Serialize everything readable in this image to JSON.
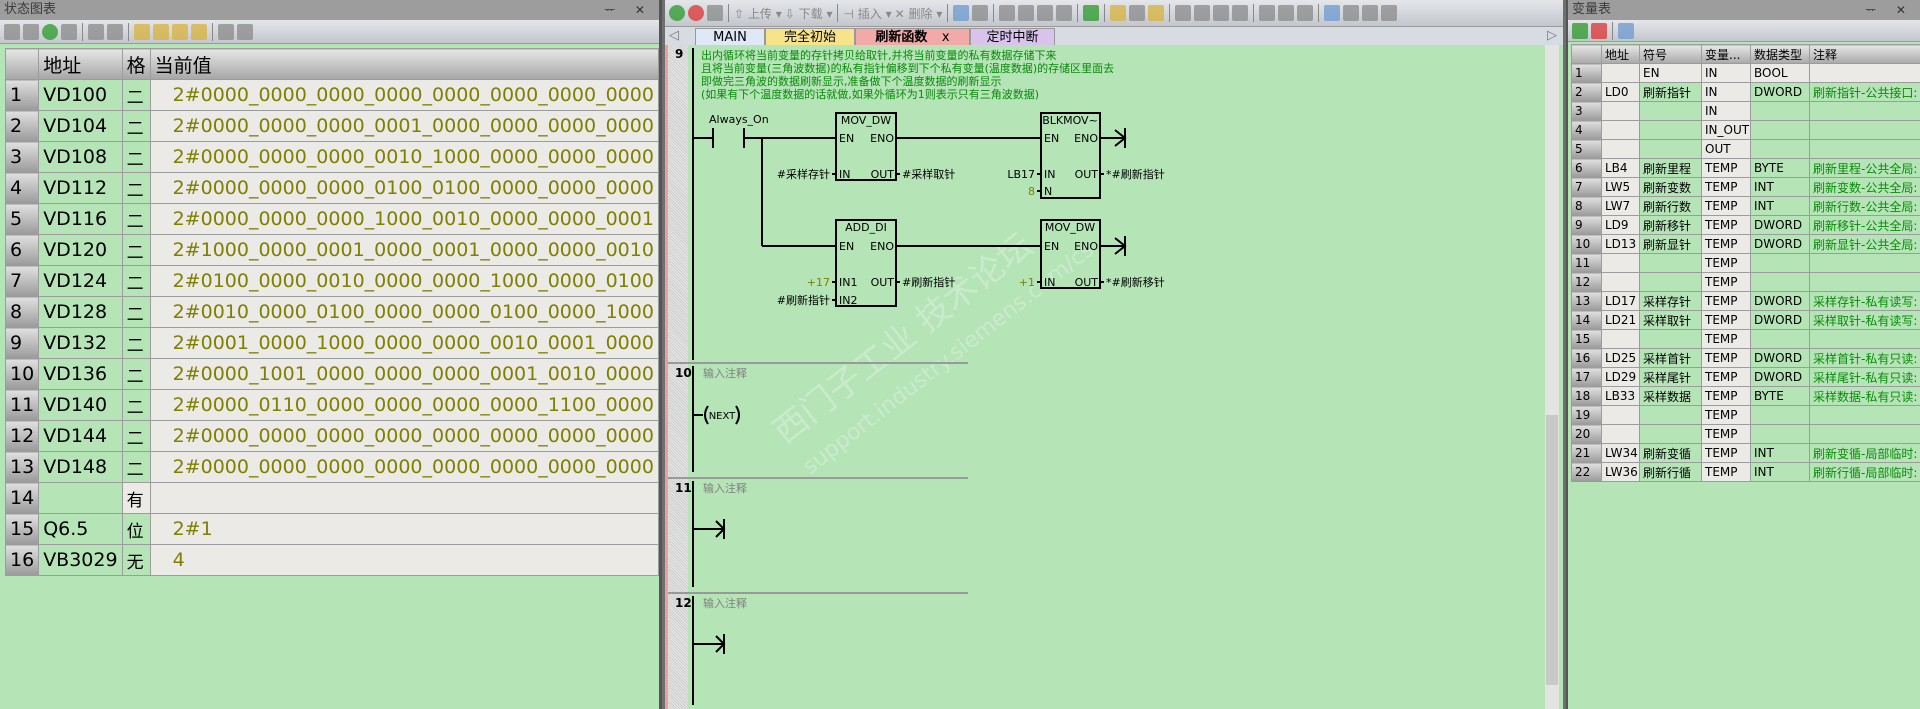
{
  "status_chart": {
    "title": "状态图表",
    "window_controls": "ᅲ ✕",
    "toolbar_icons": [
      "add-row-icon",
      "delete-row-icon",
      "chart-run-icon",
      "pause-icon",
      "read-icon",
      "write-icon",
      "force-icon",
      "unforce-icon",
      "unforce-all-icon",
      "read-forced-icon",
      "trend-icon",
      "tag-icon"
    ],
    "columns": [
      "",
      "地址",
      "格",
      "当前值"
    ],
    "rows": [
      {
        "n": "1",
        "addr": "VD100",
        "fmt": "二",
        "value": "2#0000_0000_0000_0000_0000_0000_0000_0000"
      },
      {
        "n": "2",
        "addr": "VD104",
        "fmt": "二",
        "value": "2#0000_0000_0000_0001_0000_0000_0000_0000"
      },
      {
        "n": "3",
        "addr": "VD108",
        "fmt": "二",
        "value": "2#0000_0000_0000_0010_1000_0000_0000_0000"
      },
      {
        "n": "4",
        "addr": "VD112",
        "fmt": "二",
        "value": "2#0000_0000_0000_0100_0100_0000_0000_0000"
      },
      {
        "n": "5",
        "addr": "VD116",
        "fmt": "二",
        "value": "2#0000_0000_0000_1000_0010_0000_0000_0001"
      },
      {
        "n": "6",
        "addr": "VD120",
        "fmt": "二",
        "value": "2#1000_0000_0001_0000_0001_0000_0000_0010"
      },
      {
        "n": "7",
        "addr": "VD124",
        "fmt": "二",
        "value": "2#0100_0000_0010_0000_0000_1000_0000_0100"
      },
      {
        "n": "8",
        "addr": "VD128",
        "fmt": "二",
        "value": "2#0010_0000_0100_0000_0000_0100_0000_1000"
      },
      {
        "n": "9",
        "addr": "VD132",
        "fmt": "二",
        "value": "2#0001_0000_1000_0000_0000_0010_0001_0000"
      },
      {
        "n": "10",
        "addr": "VD136",
        "fmt": "二",
        "value": "2#0000_1001_0000_0000_0000_0001_0010_0000"
      },
      {
        "n": "11",
        "addr": "VD140",
        "fmt": "二",
        "value": "2#0000_0110_0000_0000_0000_0000_1100_0000"
      },
      {
        "n": "12",
        "addr": "VD144",
        "fmt": "二",
        "value": "2#0000_0000_0000_0000_0000_0000_0000_0000"
      },
      {
        "n": "13",
        "addr": "VD148",
        "fmt": "二",
        "value": "2#0000_0000_0000_0000_0000_0000_0000_0000"
      },
      {
        "n": "14",
        "addr": "",
        "fmt": "有",
        "value": ""
      },
      {
        "n": "15",
        "addr": "Q6.5",
        "fmt": "位",
        "value": "2#1"
      },
      {
        "n": "16",
        "addr": "VB3029",
        "fmt": "无",
        "value": "4"
      }
    ]
  },
  "editor": {
    "toolbar": {
      "upload": "上传",
      "download": "下载",
      "insert": "插入",
      "delete": "删除"
    },
    "tabs": [
      {
        "label": "MAIN",
        "color": "#dfe8f6"
      },
      {
        "label": "完全初始",
        "color": "#f7e38a"
      },
      {
        "label": "刷新函数",
        "color": "#f2aaa8",
        "active": true,
        "close": "x"
      },
      {
        "label": "定时中断",
        "color": "#d9c3ec"
      }
    ],
    "networks": [
      {
        "no": "9",
        "comment": [
          "出内循环将当前变量的存针拷贝给取针,并将当前变量的私有数据存储下来",
          "且将当前变量(三角波数据)的私有指针偏移到下个私有变量(温度数据)的存储区里面去",
          "即做完三角波的数据刷新显示,准备做下个温度数据的刷新显示",
          "(如果有下个温度数据的话就做,如果外循环为1则表示只有三角波数据)"
        ],
        "contact": "Always_On",
        "boxes": [
          {
            "name": "MOV_DW",
            "en": "EN",
            "eno": "ENO",
            "in": [
              {
                "pin": "IN",
                "operand": "#采样存针"
              }
            ],
            "out": [
              {
                "pin": "OUT",
                "operand": "#采样取针"
              }
            ]
          },
          {
            "name": "BLKMOV~",
            "en": "EN",
            "eno": "ENO",
            "in": [
              {
                "pin": "IN",
                "operand": "LB17"
              },
              {
                "pin": "N",
                "operand": "8"
              }
            ],
            "out": [
              {
                "pin": "OUT",
                "operand": "*#刷新指针"
              }
            ]
          },
          {
            "name": "ADD_DI",
            "en": "EN",
            "eno": "ENO",
            "in": [
              {
                "pin": "IN1",
                "operand": "+17"
              },
              {
                "pin": "IN2",
                "operand": "#刷新指针"
              }
            ],
            "out": [
              {
                "pin": "OUT",
                "operand": "#刷新指针"
              }
            ]
          },
          {
            "name": "MOV_DW",
            "en": "EN",
            "eno": "ENO",
            "in": [
              {
                "pin": "IN",
                "operand": "+1"
              }
            ],
            "out": [
              {
                "pin": "OUT",
                "operand": "*#刷新移针"
              }
            ]
          }
        ]
      },
      {
        "no": "10",
        "comment": "输入注释",
        "coil": "NEXT"
      },
      {
        "no": "11",
        "comment": "输入注释"
      },
      {
        "no": "12",
        "comment": "输入注释"
      }
    ],
    "watermark": {
      "line1": "西门子工业 技术论坛",
      "line2": "support.industry.siemens.com/cs"
    }
  },
  "var_table": {
    "title": "变量表",
    "window_controls": "ᅲ ✕",
    "columns": [
      "",
      "地址",
      "符号",
      "变量...",
      "数据类型",
      "注释"
    ],
    "rows": [
      [
        "1",
        "",
        "EN",
        "IN",
        "BOOL",
        ""
      ],
      [
        "2",
        "LD0",
        "刷新指针",
        "IN",
        "DWORD",
        "刷新指针-公共接口:"
      ],
      [
        "3",
        "",
        "",
        "IN",
        "",
        ""
      ],
      [
        "4",
        "",
        "",
        "IN_OUT",
        "",
        ""
      ],
      [
        "5",
        "",
        "",
        "OUT",
        "",
        ""
      ],
      [
        "6",
        "LB4",
        "刷新里程",
        "TEMP",
        "BYTE",
        "刷新里程-公共全局:"
      ],
      [
        "7",
        "LW5",
        "刷新变数",
        "TEMP",
        "INT",
        "刷新变数-公共全局:"
      ],
      [
        "8",
        "LW7",
        "刷新行数",
        "TEMP",
        "INT",
        "刷新行数-公共全局:"
      ],
      [
        "9",
        "LD9",
        "刷新移针",
        "TEMP",
        "DWORD",
        "刷新移针-公共全局:"
      ],
      [
        "10",
        "LD13",
        "刷新显针",
        "TEMP",
        "DWORD",
        "刷新显针-公共全局:"
      ],
      [
        "11",
        "",
        "",
        "TEMP",
        "",
        ""
      ],
      [
        "12",
        "",
        "",
        "TEMP",
        "",
        ""
      ],
      [
        "13",
        "LD17",
        "采样存针",
        "TEMP",
        "DWORD",
        "采样存针-私有读写:"
      ],
      [
        "14",
        "LD21",
        "采样取针",
        "TEMP",
        "DWORD",
        "采样取针-私有读写:"
      ],
      [
        "15",
        "",
        "",
        "TEMP",
        "",
        ""
      ],
      [
        "16",
        "LD25",
        "采样首针",
        "TEMP",
        "DWORD",
        "采样首针-私有只读:"
      ],
      [
        "17",
        "LD29",
        "采样尾针",
        "TEMP",
        "DWORD",
        "采样尾针-私有只读:"
      ],
      [
        "18",
        "LB33",
        "采样数据",
        "TEMP",
        "BYTE",
        "采样数据-私有只读:"
      ],
      [
        "19",
        "",
        "",
        "TEMP",
        "",
        ""
      ],
      [
        "20",
        "",
        "",
        "TEMP",
        "",
        ""
      ],
      [
        "21",
        "LW34",
        "刷新变循",
        "TEMP",
        "INT",
        "刷新变循-局部临时:"
      ],
      [
        "22",
        "LW36",
        "刷新行循",
        "TEMP",
        "INT",
        "刷新行循-局部临时:"
      ]
    ]
  }
}
